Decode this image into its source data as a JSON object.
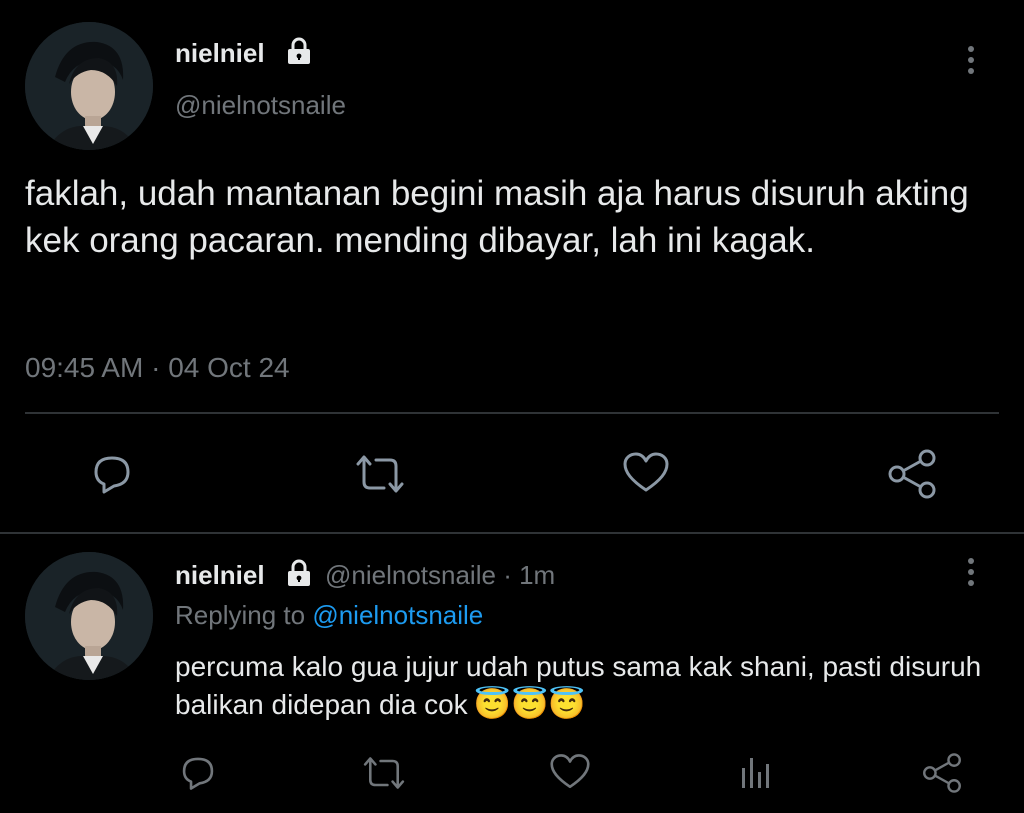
{
  "main_tweet": {
    "display_name": "nielniel",
    "handle": "@nielnotsnaile",
    "text": "faklah, udah mantanan begini masih aja harus disuruh akting kek orang pacaran. mending dibayar, lah ini kagak.",
    "time": "09:45 AM",
    "separator": "·",
    "date": "04 Oct 24",
    "protected_icon": "lock-icon",
    "actions": [
      "reply-icon",
      "retweet-icon",
      "like-icon",
      "share-icon"
    ]
  },
  "reply_tweet": {
    "display_name": "nielniel",
    "handle": "@nielnotsnaile",
    "separator": "·",
    "age": "1m",
    "replying_prefix": "Replying to",
    "replying_handle": "@nielnotsnaile",
    "text": "percuma kalo gua jujur udah putus sama kak shani, pasti disuruh balikan didepan dia  cok",
    "emojis": [
      "😇",
      "😇",
      "😇"
    ],
    "actions": [
      "reply-icon",
      "retweet-icon",
      "like-icon",
      "analytics-icon",
      "share-icon"
    ]
  },
  "colors": {
    "background": "#000000",
    "text": "#e7e9ea",
    "muted": "#71767b",
    "link": "#1d9bf0",
    "divider": "#2f3336"
  }
}
